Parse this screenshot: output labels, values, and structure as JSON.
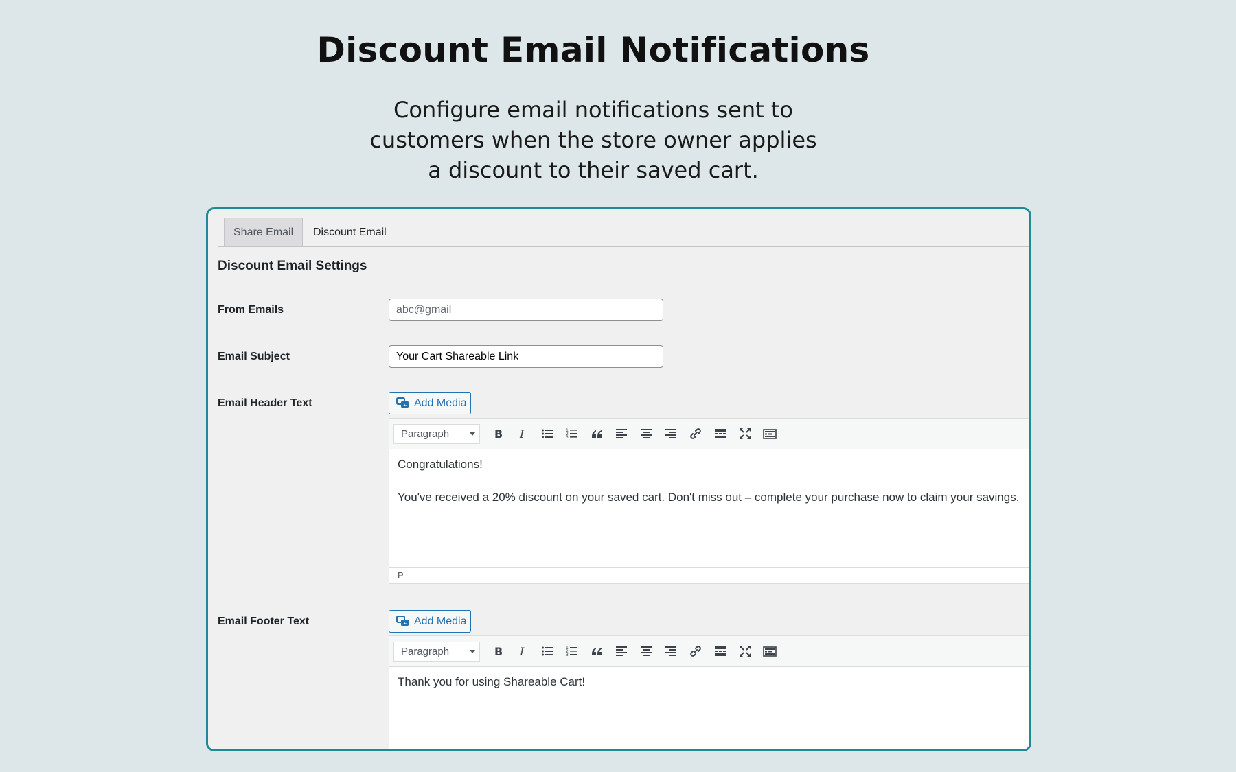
{
  "hero": {
    "title": "Discount Email Notifications",
    "subtitle_lines": [
      "Configure email notifications sent to",
      "customers when the store owner applies",
      "a discount to their saved cart."
    ]
  },
  "tabs": [
    {
      "label": "Share Email",
      "active": false
    },
    {
      "label": "Discount Email",
      "active": true
    }
  ],
  "section_title": "Discount Email Settings",
  "fields": {
    "from_emails": {
      "label": "From Emails",
      "value": "",
      "placeholder": "abc@gmail"
    },
    "email_subject": {
      "label": "Email Subject",
      "value": "Your Cart Shareable Link"
    },
    "header_text": {
      "label": "Email Header Text",
      "add_media_label": "Add Media",
      "format": "Paragraph",
      "paragraphs": [
        "Congratulations!",
        "You've received a 20% discount on your saved cart. Don't miss out – complete your purchase now to claim your savings."
      ],
      "status_path": "P"
    },
    "footer_text": {
      "label": "Email Footer Text",
      "add_media_label": "Add Media",
      "format": "Paragraph",
      "paragraphs": [
        "Thank you for using Shareable Cart!"
      ]
    }
  },
  "toolbar_icons": [
    "bold-icon",
    "italic-icon",
    "bullet-list-icon",
    "numbered-list-icon",
    "blockquote-icon",
    "align-left-icon",
    "align-center-icon",
    "align-right-icon",
    "link-icon",
    "read-more-icon",
    "fullscreen-icon",
    "toolbar-toggle-icon"
  ],
  "colors": {
    "accent": "#1f8a96",
    "link": "#2271b1",
    "background": "#dde7ea"
  }
}
